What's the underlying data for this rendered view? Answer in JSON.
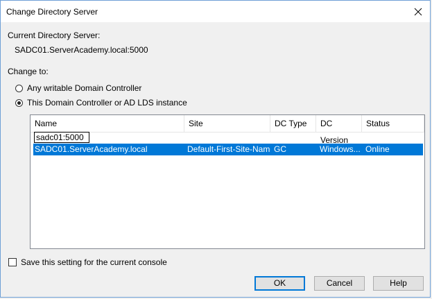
{
  "window": {
    "title": "Change Directory Server"
  },
  "current": {
    "label": "Current Directory Server:",
    "value": "SADC01.ServerAcademy.local:5000"
  },
  "change_to": {
    "label": "Change to:",
    "options": [
      {
        "label": "Any writable Domain Controller",
        "checked": false
      },
      {
        "label": "This Domain Controller or AD LDS instance",
        "checked": true
      }
    ]
  },
  "list": {
    "columns": [
      "Name",
      "Site",
      "DC Type",
      "DC Version",
      "Status"
    ],
    "edit_value": "sadc01:5000",
    "rows": [
      {
        "name": "SADC01.ServerAcademy.local",
        "site": "Default-First-Site-Name",
        "dc_type": "GC",
        "dc_version": "Windows...",
        "status": "Online",
        "selected": true
      }
    ]
  },
  "save_setting": {
    "label": "Save this setting for the current console",
    "checked": false
  },
  "buttons": {
    "ok": "OK",
    "cancel": "Cancel",
    "help": "Help"
  },
  "colors": {
    "selection": "#0078d7",
    "window_border": "#6e9fd6",
    "background": "#f0f0f0"
  }
}
